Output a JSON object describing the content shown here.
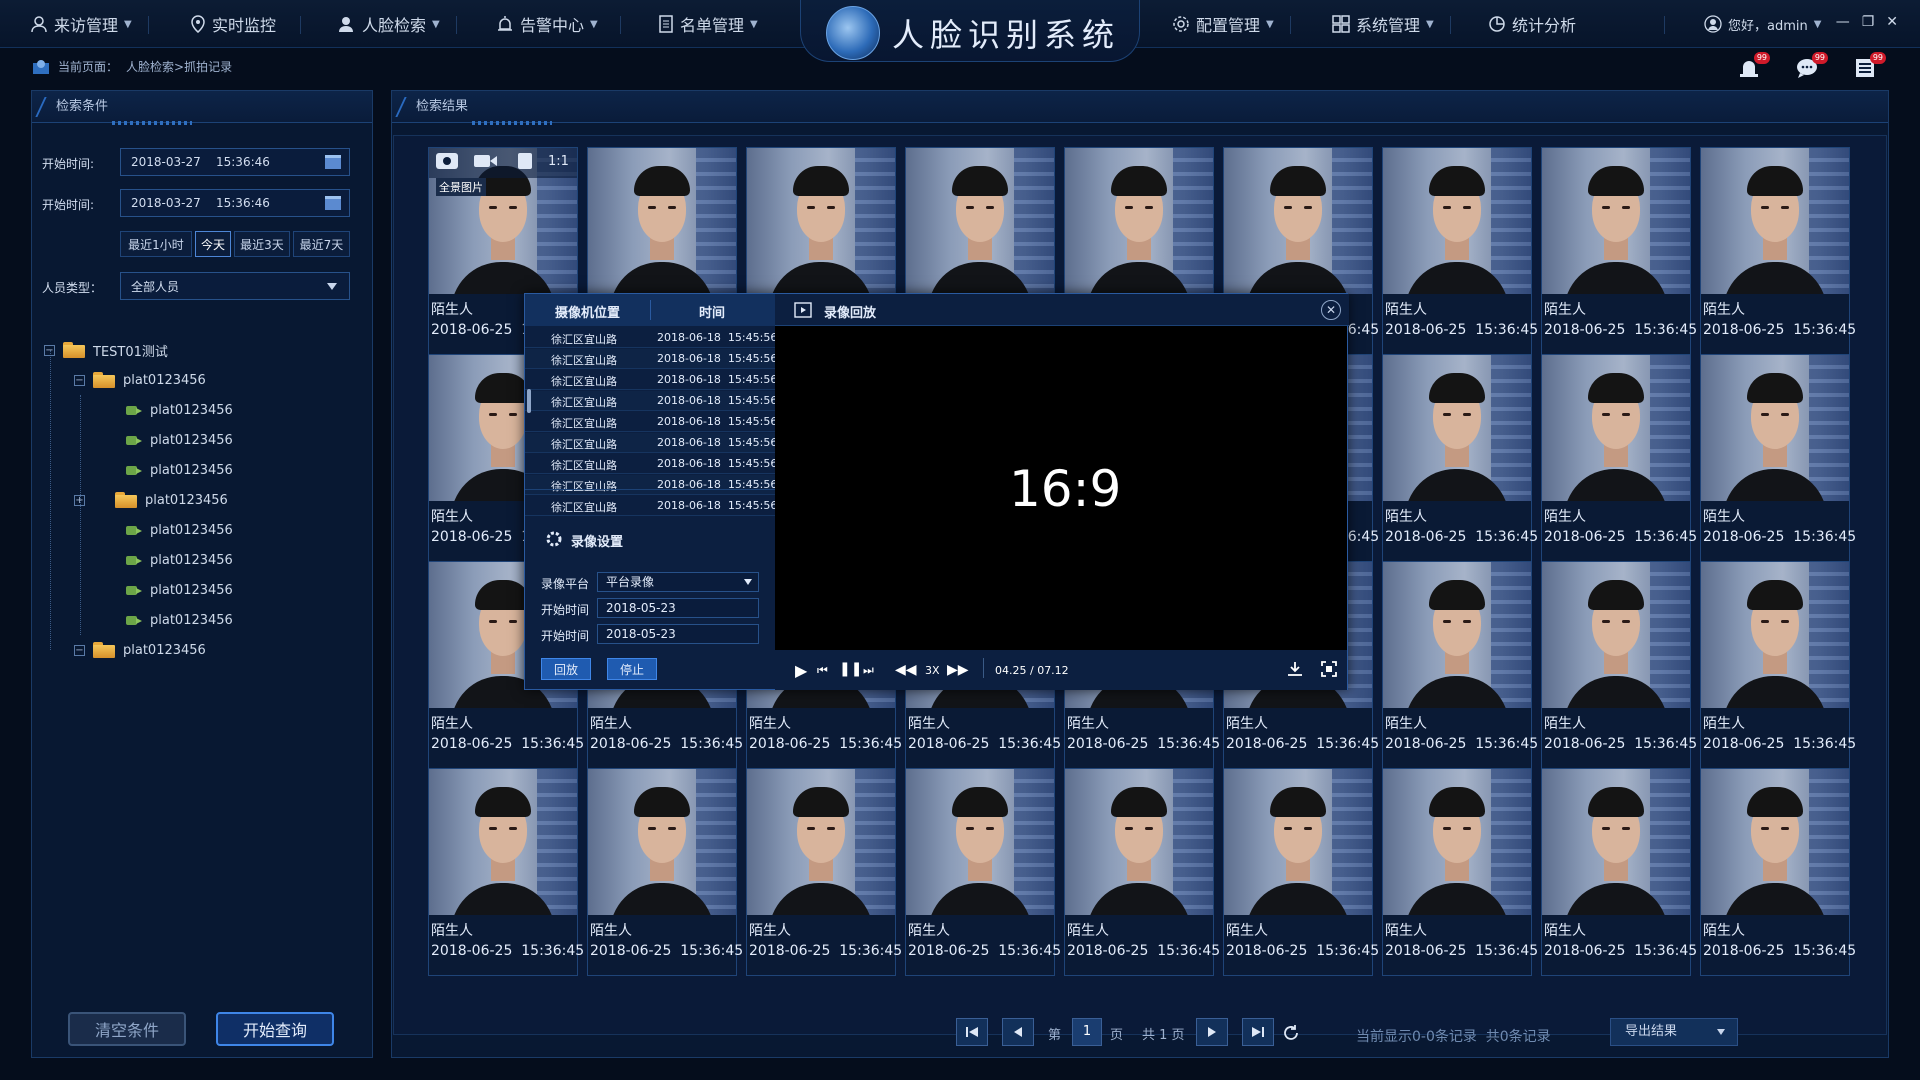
{
  "nav": {
    "left": [
      {
        "label": "来访管理",
        "icon": "user-icon"
      },
      {
        "label": "实时监控",
        "icon": "location-icon"
      },
      {
        "label": "人脸检索",
        "icon": "face-search-icon"
      },
      {
        "label": "告警中心",
        "icon": "alarm-icon"
      },
      {
        "label": "名单管理",
        "icon": "list-icon"
      }
    ],
    "right": [
      {
        "label": "配置管理",
        "icon": "gear-icon"
      },
      {
        "label": "系统管理",
        "icon": "grid-icon"
      },
      {
        "label": "统计分析",
        "icon": "pie-chart-icon"
      }
    ],
    "app_title": "人脸识别系统",
    "user_greeting": "您好，admin"
  },
  "breadcrumb": {
    "label": "当前页面：",
    "path": "人脸检索>抓拍记录"
  },
  "header_icons": [
    {
      "name": "alarm-bell-icon",
      "badge": "99"
    },
    {
      "name": "message-icon",
      "badge": "99"
    },
    {
      "name": "task-list-icon",
      "badge": "99"
    }
  ],
  "search": {
    "title": "检索条件",
    "start_label": "开始时间:",
    "start_value": "2018-03-27    15:36:46",
    "end_label": "开始时间:",
    "end_value": "2018-03-27    15:36:46",
    "quick_ranges": [
      "最近1小时",
      "今天",
      "最近3天",
      "最近7天"
    ],
    "quick_selected": 1,
    "person_type_label": "人员类型：",
    "person_type_value": "全部人员",
    "clear_label": "清空条件",
    "query_label": "开始查询"
  },
  "tree": {
    "root": "TEST01测试",
    "nodes": [
      {
        "label": "plat0123456",
        "type": "folder",
        "toggle": "−"
      },
      {
        "label": "plat0123456",
        "type": "camera"
      },
      {
        "label": "plat0123456",
        "type": "camera"
      },
      {
        "label": "plat0123456",
        "type": "camera"
      },
      {
        "label": "plat0123456",
        "type": "folder",
        "toggle": "+"
      },
      {
        "label": "plat0123456",
        "type": "camera"
      },
      {
        "label": "plat0123456",
        "type": "camera"
      },
      {
        "label": "plat0123456",
        "type": "camera"
      },
      {
        "label": "plat0123456",
        "type": "camera"
      },
      {
        "label": "plat0123456",
        "type": "folder",
        "toggle": "−"
      }
    ]
  },
  "results": {
    "title": "检索结果",
    "card_name": "陌生人",
    "card_time": "2018-06-25  15:36:45",
    "hover_tools": {
      "full_image_label": "全景图片",
      "ratio_label": "1:1"
    }
  },
  "modal": {
    "col_location": "摄像机位置",
    "col_time": "时间",
    "rows_location": "徐汇区宜山路",
    "rows_time": "2018-06-18  15:45:56",
    "title": "录像回放",
    "aspect_text": "16:9",
    "settings_title": "录像设置",
    "platform_label": "录像平台",
    "platform_value": "平台录像",
    "start_label": "开始时间",
    "start_value": "2018-05-23",
    "end_label": "开始时间",
    "end_value": "2018-05-23",
    "playback_label": "回放",
    "stop_label": "停止",
    "speed": "3X",
    "time": "04.25 / 07.12"
  },
  "pager": {
    "page_prefix": "第",
    "page_value": "1",
    "page_suffix": "页",
    "total_pages": "共 1 页",
    "records_text": "当前显示0-0条记录  共0条记录",
    "export_label": "导出结果"
  },
  "colors": {
    "accent": "#3d7bd6",
    "panel_bg": "#081832",
    "page_bg": "#050d1c"
  }
}
